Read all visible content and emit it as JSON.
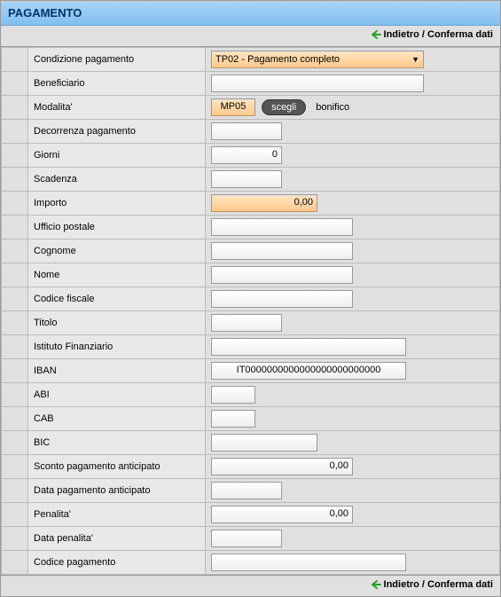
{
  "title": "PAGAMENTO",
  "toolbar": {
    "back_confirm": "Indietro / Conferma dati"
  },
  "labels": {
    "condizione": "Condizione pagamento",
    "beneficiario": "Beneficiario",
    "modalita": "Modalita'",
    "decorrenza": "Decorrenza pagamento",
    "giorni": "Giorni",
    "scadenza": "Scadenza",
    "importo": "Importo",
    "ufficio": "Ufficio postale",
    "cognome": "Cognome",
    "nome": "Nome",
    "codfisc": "Codice fiscale",
    "titolo": "Titolo",
    "istituto": "Istituto Finanziario",
    "iban": "IBAN",
    "abi": "ABI",
    "cab": "CAB",
    "bic": "BIC",
    "sconto": "Sconto pagamento anticipato",
    "data_sconto": "Data pagamento anticipato",
    "penalita": "Penalita'",
    "data_penalita": "Data penalita'",
    "codice_pag": "Codice pagamento"
  },
  "values": {
    "condizione": "TP02 - Pagamento completo",
    "beneficiario": "",
    "modalita_code": "MP05",
    "modalita_button": "scegli",
    "modalita_text": "bonifico",
    "decorrenza": "",
    "giorni": "0",
    "scadenza": "",
    "importo": "0,00",
    "ufficio": "",
    "cognome": "",
    "nome": "",
    "codfisc": "",
    "titolo": "",
    "istituto": "",
    "iban": "IT0000000000000000000000000",
    "abi": "",
    "cab": "",
    "bic": "",
    "sconto": "0,00",
    "data_sconto": "",
    "penalita": "0,00",
    "data_penalita": "",
    "codice_pag": ""
  }
}
